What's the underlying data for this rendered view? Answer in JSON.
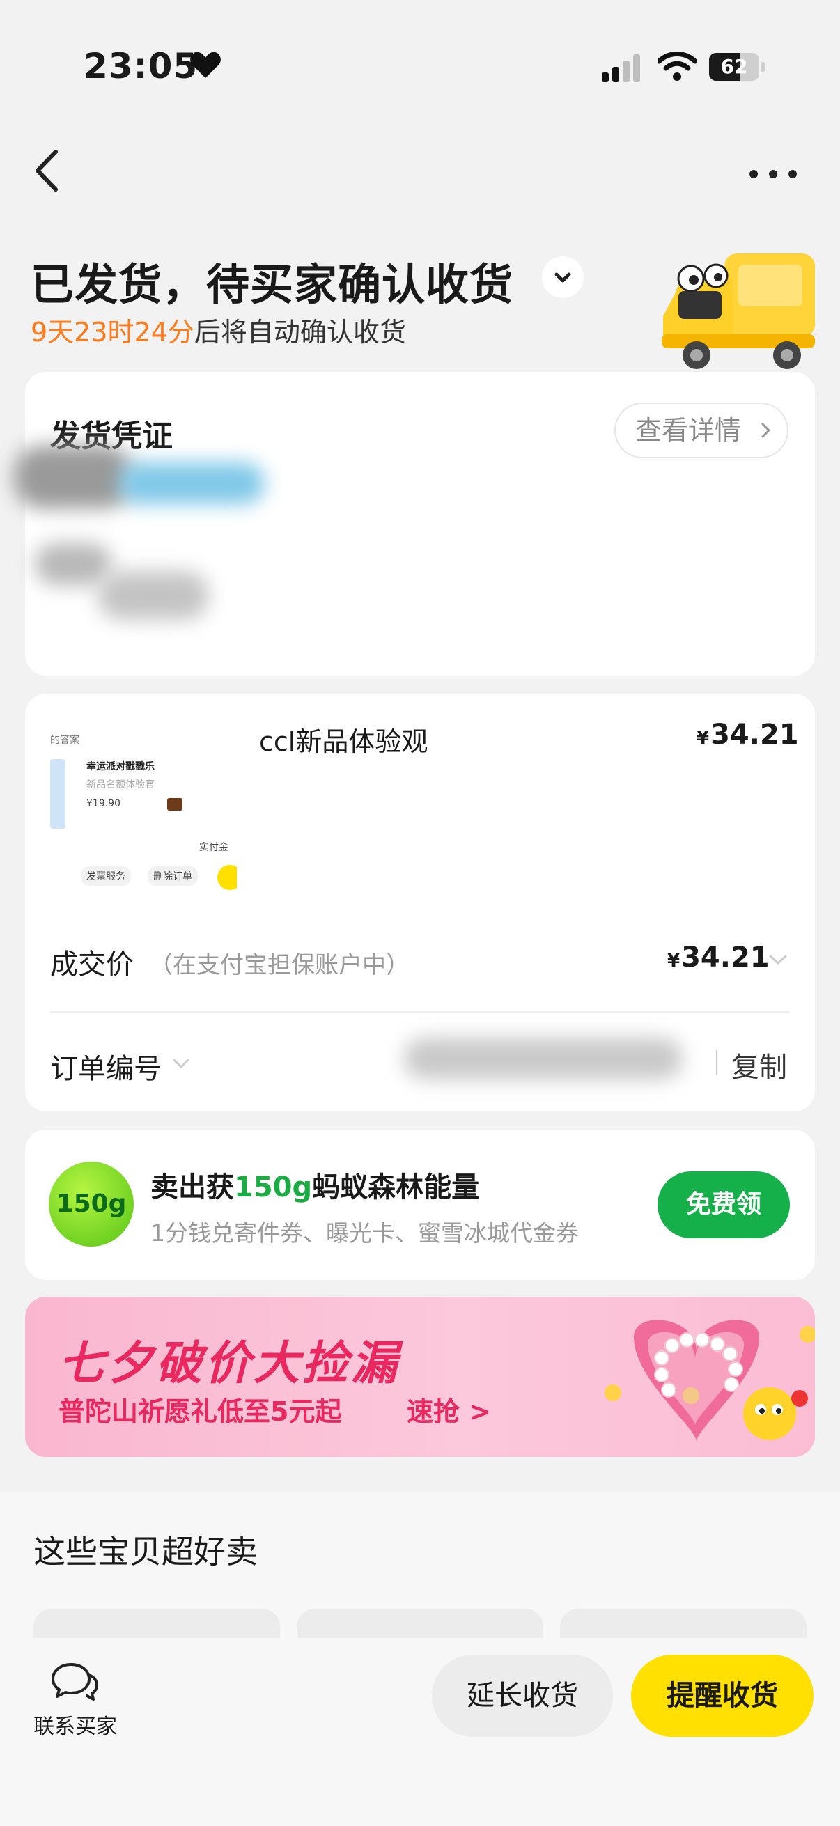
{
  "status_bar": {
    "time": "23:05",
    "battery": "62",
    "battery_level": 0.62
  },
  "header": {
    "title": "已发货，待买家确认收货",
    "countdown_time": "9天23时24分",
    "countdown_suffix": "后将自动确认收货"
  },
  "shipping_proof": {
    "title": "发货凭证",
    "detail_label": "查看详情"
  },
  "order": {
    "product_name": "ccl新品体验观",
    "currency": "¥",
    "product_price": "34.21",
    "thumbnail": {
      "answer_label": "的答案",
      "game_title": "幸运派对戳戳乐",
      "game_sub": "新品名额体验官",
      "price": "¥19.90",
      "actual_label": "实付金",
      "invoice_btn": "发票服务",
      "delete_btn": "删除订单"
    },
    "deal_label": "成交价",
    "deal_note": "（在支付宝担保账户中）",
    "deal_price": "34.21",
    "order_no_label": "订单编号",
    "copy_label": "复制"
  },
  "energy": {
    "badge": "150g",
    "title_prefix": "卖出获",
    "title_highlight": "150g",
    "title_suffix": "蚂蚁森林能量",
    "subtitle": "1分钱兑寄件券、曝光卡、蜜雪冰城代金券",
    "button": "免费领"
  },
  "banner": {
    "title": "七夕破价大捡漏",
    "subtitle": "普陀山祈愿礼低至5元起",
    "cta": "速抢"
  },
  "recommend": {
    "title": "这些宝贝超好卖"
  },
  "bottom_bar": {
    "contact_label": "联系买家",
    "extend_button": "延长收货",
    "remind_button": "提醒收货"
  },
  "colors": {
    "accent_orange": "#ff7a1a",
    "green": "#16b04a",
    "yellow": "#ffe000",
    "pink": "#e8285f"
  },
  "icons": [
    "heart-icon",
    "signal-icon",
    "wifi-icon",
    "battery-icon",
    "back-icon",
    "more-icon",
    "chevron-down-icon",
    "truck-illustration",
    "chevron-right-icon",
    "chat-icon"
  ]
}
